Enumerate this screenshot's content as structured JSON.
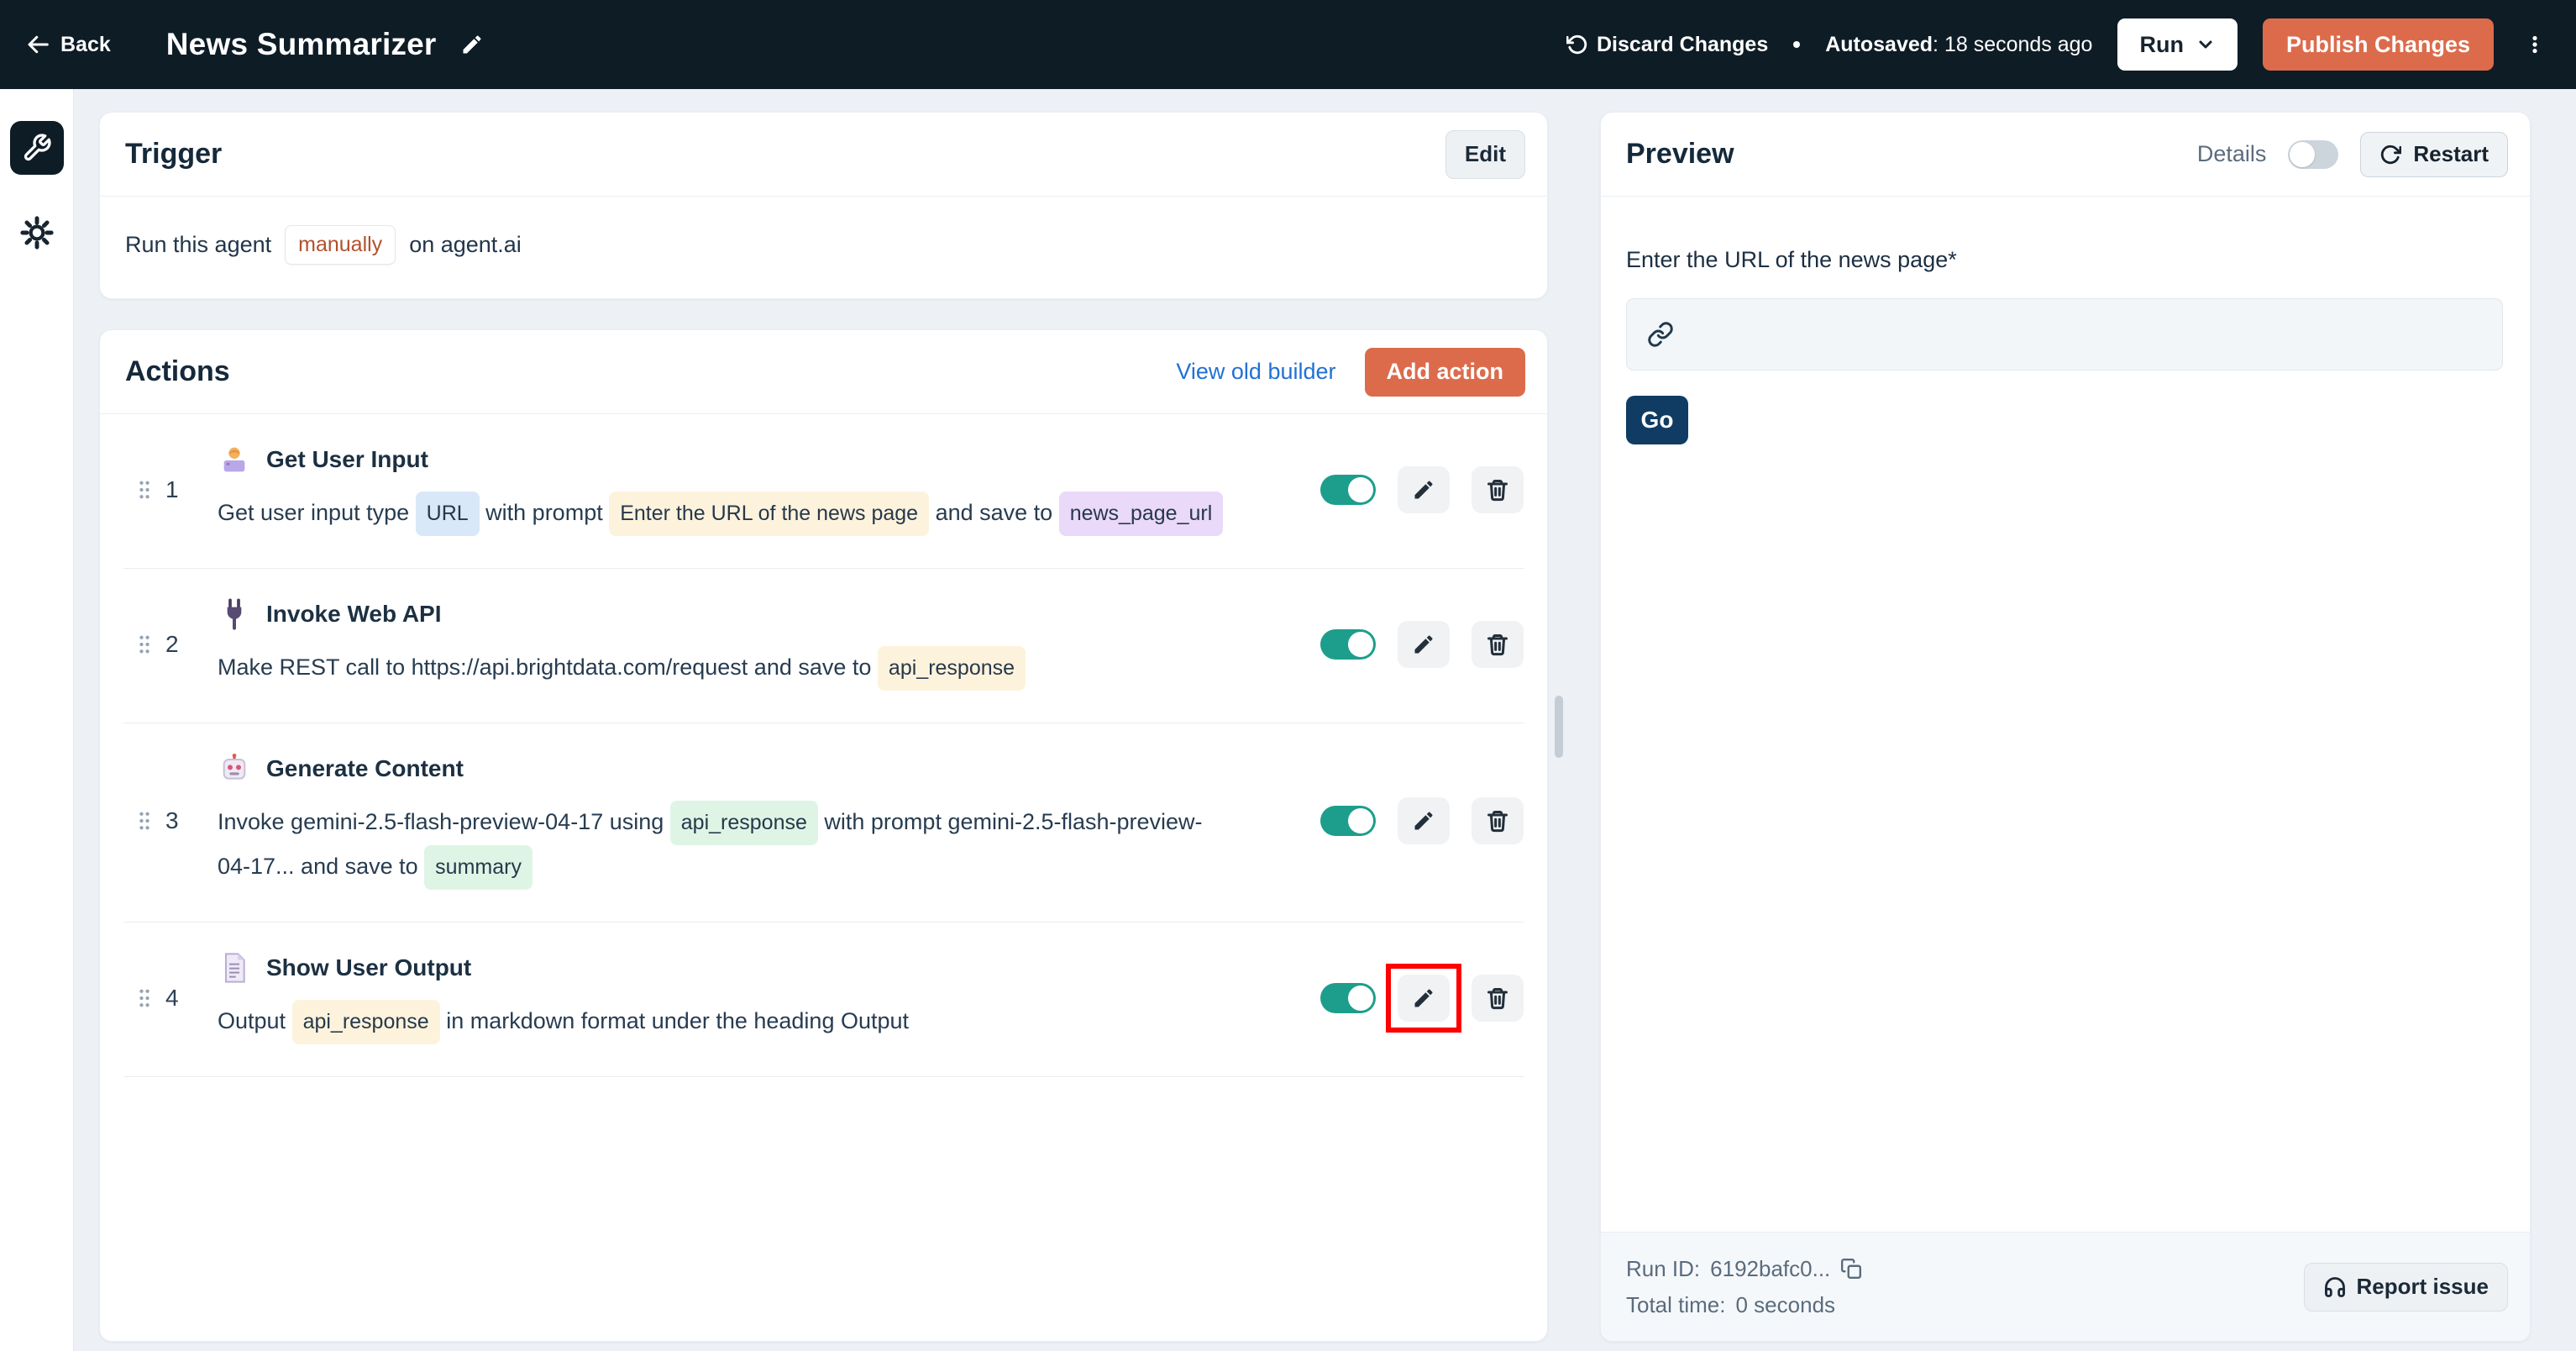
{
  "topbar": {
    "back_label": "Back",
    "title": "News Summarizer",
    "discard_label": "Discard Changes",
    "autosaved_label": "Autosaved",
    "autosaved_value": ": 18 seconds ago",
    "run_label": "Run",
    "publish_label": "Publish Changes"
  },
  "trigger": {
    "title": "Trigger",
    "edit_label": "Edit",
    "run_prefix": "Run this agent",
    "run_mode_badge": "manually",
    "run_suffix": "on agent.ai"
  },
  "actions": {
    "title": "Actions",
    "view_old_builder_label": "View old builder",
    "add_action_label": "Add action",
    "rows": [
      {
        "num": "1",
        "icon": "technologist-emoji",
        "title": "Get User Input",
        "enabled": true,
        "highlight_edit": false,
        "segments": [
          {
            "text": "Get user input type "
          },
          {
            "badge": "URL",
            "style": "blue"
          },
          {
            "text": " with prompt "
          },
          {
            "badge": "Enter the URL of the news page",
            "style": "cream"
          },
          {
            "text": " and save to "
          },
          {
            "badge": "news_page_url",
            "style": "purple"
          }
        ]
      },
      {
        "num": "2",
        "icon": "plug-emoji",
        "title": "Invoke Web API",
        "enabled": true,
        "highlight_edit": false,
        "segments": [
          {
            "text": "Make REST call to https://api.brightdata.com/request and save to "
          },
          {
            "badge": "api_response",
            "style": "cream"
          }
        ]
      },
      {
        "num": "3",
        "icon": "robot-emoji",
        "title": "Generate Content",
        "enabled": true,
        "highlight_edit": false,
        "segments": [
          {
            "text": "Invoke gemini-2.5-flash-preview-04-17 using "
          },
          {
            "badge": "api_response",
            "style": "green"
          },
          {
            "text": " with prompt gemini-2.5-flash-preview-"
          },
          {
            "br": true
          },
          {
            "text": "04-17... and save to "
          },
          {
            "badge": "summary",
            "style": "green"
          }
        ]
      },
      {
        "num": "4",
        "icon": "page-emoji",
        "title": "Show User Output",
        "enabled": true,
        "highlight_edit": true,
        "segments": [
          {
            "text": "Output "
          },
          {
            "badge": "api_response",
            "style": "cream"
          },
          {
            "text": " in markdown format under the heading Output"
          }
        ]
      }
    ]
  },
  "preview": {
    "title": "Preview",
    "details_label": "Details",
    "restart_label": "Restart",
    "input_label": "Enter the URL of the news page*",
    "input_value": "",
    "go_label": "Go",
    "run_id_label": "Run ID:",
    "run_id_value": "6192bafc0...",
    "total_time_label": "Total time:",
    "total_time_value": "0 seconds",
    "report_issue_label": "Report issue"
  },
  "colors": {
    "topbar_bg": "#0e1c26",
    "accent_orange": "#dc6b4c",
    "toggle_teal": "#1d9e8c",
    "link_blue": "#2271d3",
    "go_navy": "#103c64",
    "annotation_red": "#ff0000",
    "badge_blue": "#d9e8f8",
    "badge_cream": "#fdf3dd",
    "badge_purple": "#ead9f9",
    "badge_green": "#def5e6"
  }
}
